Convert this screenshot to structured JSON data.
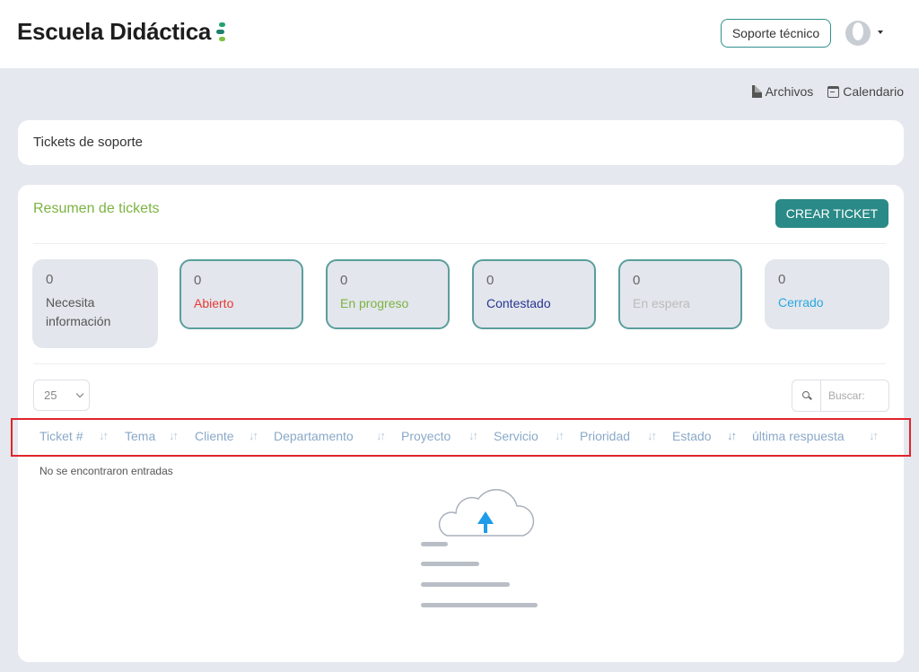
{
  "header": {
    "logo_text": "Escuela Didáctica",
    "support_label": "Soporte técnico",
    "avatar_icon": "user-avatar-icon",
    "menu_icon": "caret-down-icon"
  },
  "sublinks": {
    "files": "Archivos",
    "calendar": "Calendario"
  },
  "breadcrumb_card": {
    "title": "Tickets de soporte"
  },
  "summary": {
    "title": "Resumen de tickets",
    "create_label": "CREAR TICKET",
    "statuses": [
      {
        "count": "0",
        "label": "Necesita información",
        "color": "#555555"
      },
      {
        "count": "0",
        "label": "Abierto",
        "color": "#e53935"
      },
      {
        "count": "0",
        "label": "En progreso",
        "color": "#7cb342"
      },
      {
        "count": "0",
        "label": "Contestado",
        "color": "#283593"
      },
      {
        "count": "0",
        "label": "En espera",
        "color": "#bbbbbb"
      },
      {
        "count": "0",
        "label": "Cerrado",
        "color": "#29a8e0"
      }
    ]
  },
  "table": {
    "page_length": "25",
    "search_placeholder": "Buscar:",
    "columns": [
      "Ticket #",
      "Tema",
      "Cliente",
      "Departamento",
      "Proyecto",
      "Servicio",
      "Prioridad",
      "Estado",
      "última respuesta"
    ],
    "sort_glyph": "↓↑",
    "empty_message": "No se encontraron entradas"
  },
  "colors": {
    "accent": "#2a8a87",
    "highlight": "#e0242b",
    "cloud_arrow": "#1e9be9"
  }
}
